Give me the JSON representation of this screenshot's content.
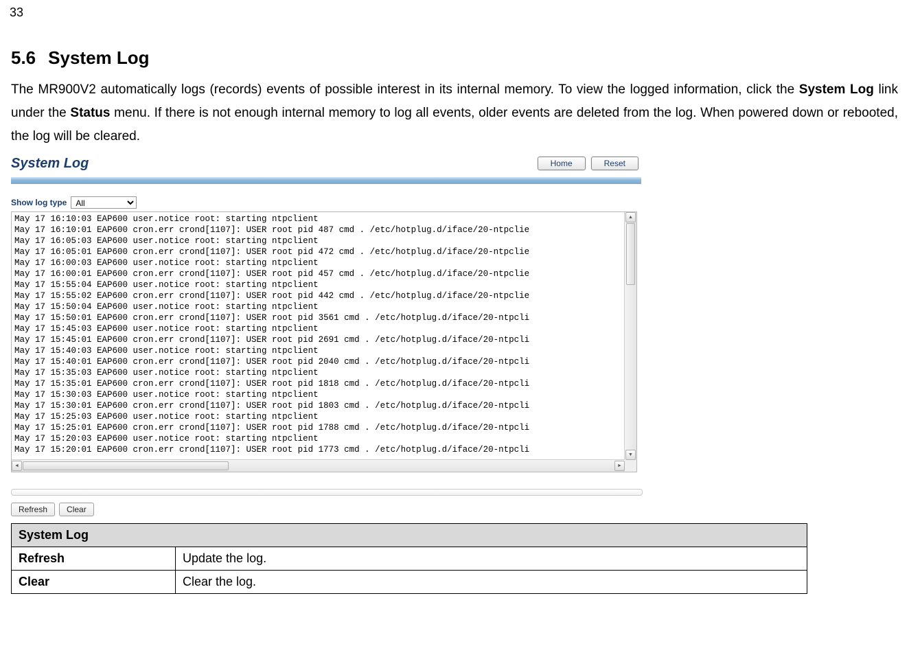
{
  "page_number": "33",
  "heading_num": "5.6",
  "heading_text": "System Log",
  "paragraph_parts": {
    "p1": "The MR900V2 automatically logs (records) events of possible interest in its internal memory. To view the logged information, click the ",
    "p2": "System Log",
    "p3": " link under the ",
    "p4": "Status",
    "p5": " menu. If there is not enough internal memory to log all events, older events are deleted from the log. When powered down or rebooted, the log will be cleared."
  },
  "screenshot": {
    "title": "System Log",
    "home_btn": "Home",
    "reset_btn": "Reset",
    "filter_label": "Show log type",
    "filter_value": "All",
    "refresh_btn": "Refresh",
    "clear_btn": "Clear",
    "log_lines": [
      "May 17 16:10:03 EAP600 user.notice root: starting ntpclient",
      "May 17 16:10:01 EAP600 cron.err crond[1107]: USER root pid 487 cmd . /etc/hotplug.d/iface/20-ntpclie",
      "May 17 16:05:03 EAP600 user.notice root: starting ntpclient",
      "May 17 16:05:01 EAP600 cron.err crond[1107]: USER root pid 472 cmd . /etc/hotplug.d/iface/20-ntpclie",
      "May 17 16:00:03 EAP600 user.notice root: starting ntpclient",
      "May 17 16:00:01 EAP600 cron.err crond[1107]: USER root pid 457 cmd . /etc/hotplug.d/iface/20-ntpclie",
      "May 17 15:55:04 EAP600 user.notice root: starting ntpclient",
      "May 17 15:55:02 EAP600 cron.err crond[1107]: USER root pid 442 cmd . /etc/hotplug.d/iface/20-ntpclie",
      "May 17 15:50:04 EAP600 user.notice root: starting ntpclient",
      "May 17 15:50:01 EAP600 cron.err crond[1107]: USER root pid 3561 cmd . /etc/hotplug.d/iface/20-ntpcli",
      "May 17 15:45:03 EAP600 user.notice root: starting ntpclient",
      "May 17 15:45:01 EAP600 cron.err crond[1107]: USER root pid 2691 cmd . /etc/hotplug.d/iface/20-ntpcli",
      "May 17 15:40:03 EAP600 user.notice root: starting ntpclient",
      "May 17 15:40:01 EAP600 cron.err crond[1107]: USER root pid 2040 cmd . /etc/hotplug.d/iface/20-ntpcli",
      "May 17 15:35:03 EAP600 user.notice root: starting ntpclient",
      "May 17 15:35:01 EAP600 cron.err crond[1107]: USER root pid 1818 cmd . /etc/hotplug.d/iface/20-ntpcli",
      "May 17 15:30:03 EAP600 user.notice root: starting ntpclient",
      "May 17 15:30:01 EAP600 cron.err crond[1107]: USER root pid 1803 cmd . /etc/hotplug.d/iface/20-ntpcli",
      "May 17 15:25:03 EAP600 user.notice root: starting ntpclient",
      "May 17 15:25:01 EAP600 cron.err crond[1107]: USER root pid 1788 cmd . /etc/hotplug.d/iface/20-ntpcli",
      "May 17 15:20:03 EAP600 user.notice root: starting ntpclient",
      "May 17 15:20:01 EAP600 cron.err crond[1107]: USER root pid 1773 cmd . /etc/hotplug.d/iface/20-ntpcli"
    ]
  },
  "desc_table": {
    "header": "System Log",
    "rows": [
      {
        "label": "Refresh",
        "desc": "Update the log."
      },
      {
        "label": "Clear",
        "desc": "Clear the log."
      }
    ]
  }
}
